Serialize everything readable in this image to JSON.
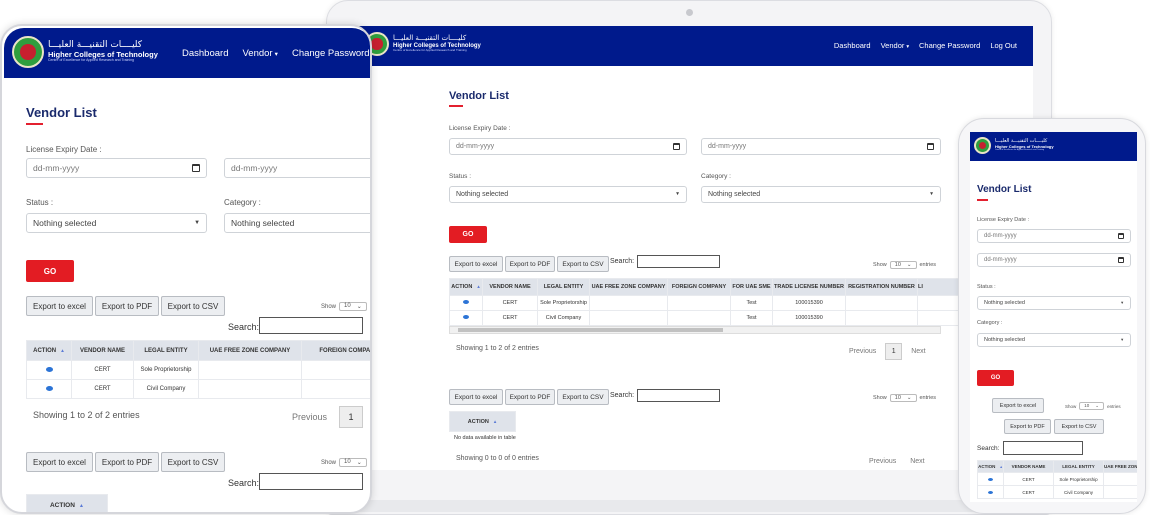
{
  "brand": {
    "arabic_name": "كليــــات التقنيـــة العليـــا",
    "english_name": "Higher Colleges of Technology",
    "tagline": "Centre of Excellence for Applied Research and Training",
    "logo_label": "CERT"
  },
  "nav": {
    "dashboard": "Dashboard",
    "vendor": "Vendor",
    "change_password": "Change Password",
    "logout": "Log Out"
  },
  "page": {
    "title": "Vendor List",
    "license_expiry_label": "License Expiry Date :",
    "date_placeholder": "dd-mm-yyyy",
    "status_label": "Status :",
    "category_label": "Category :",
    "nothing_selected": "Nothing selected",
    "go": "GO"
  },
  "exports": {
    "excel": "Export to excel",
    "pdf": "Export to PDF",
    "csv": "Export to CSV",
    "search_label": "Search:",
    "show_label": "Show",
    "show_value": "10",
    "entries_label": "entries"
  },
  "vendor_table": {
    "columns": [
      "ACTION",
      "VENDOR NAME",
      "LEGAL ENTITY",
      "UAE FREE ZONE COMPANY",
      "FOREIGN COMPANY",
      "FOR UAE SME",
      "TRADE LICENSE NUMBER",
      "REGISTRATION NUMBER",
      "LI"
    ],
    "rows": [
      {
        "vendor_name": "CERT",
        "legal_entity": "Sole Proprietorship",
        "uae_free_zone": "",
        "foreign": "",
        "uae_sme": "Test",
        "trade_license": "100015390",
        "registration": ""
      },
      {
        "vendor_name": "CERT",
        "legal_entity": "Civil Company",
        "uae_free_zone": "",
        "foreign": "",
        "uae_sme": "Test",
        "trade_license": "100015390",
        "registration": ""
      }
    ],
    "info": "Showing 1 to 2 of 2 entries",
    "previous": "Previous",
    "page": "1",
    "next": "Next"
  },
  "second_table": {
    "columns": [
      "ACTION"
    ],
    "empty": "No data available in table",
    "info": "Showing 0 to 0 of 0 entries",
    "previous": "Previous",
    "next": "Next"
  },
  "colors": {
    "nav_bg": "#001a8c",
    "accent_red": "#e31c23",
    "title_blue": "#1a2a6c"
  }
}
